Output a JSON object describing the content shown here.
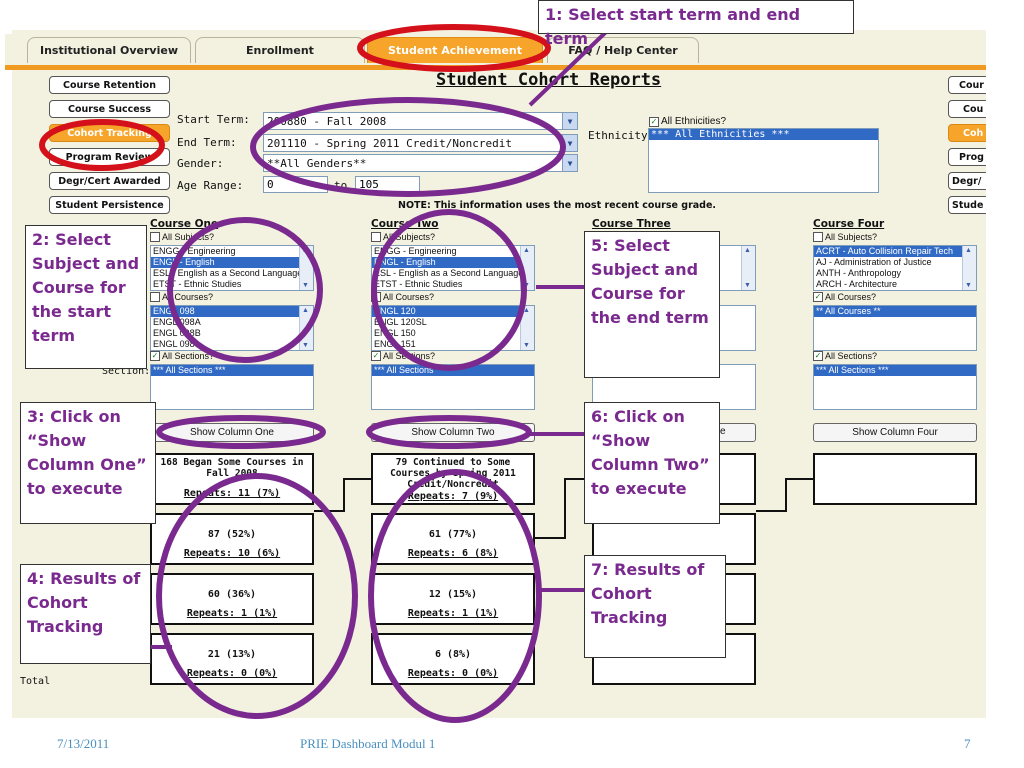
{
  "tabs": [
    "Institutional Overview",
    "Enrollment",
    "Student Achievement",
    "FAQ / Help Center"
  ],
  "page_title": "Student Cohort Reports",
  "side_buttons_left": [
    "Course Retention",
    "Course Success",
    "Cohort Tracking",
    "Program Review",
    "Degr/Cert Awarded",
    "Student Persistence"
  ],
  "side_buttons_right": [
    "Cour",
    "Cou",
    "Coh",
    "Prog",
    "Degr/",
    "Stude"
  ],
  "filters": {
    "start_term_label": "Start Term:",
    "start_term_value": "200880 - Fall 2008",
    "end_term_label": "End Term:",
    "end_term_value": "201110 - Spring 2011 Credit/Noncredit",
    "gender_label": "Gender:",
    "gender_value": "**All Genders**",
    "age_label": "Age Range:",
    "age_from": "0",
    "age_to_label": "to",
    "age_to": "105",
    "ethnicity_label": "Ethnicity:",
    "all_eth_label": "All Ethnicities?",
    "eth_value": "*** All Ethnicities ***",
    "note": "NOTE: This information uses the most recent course grade."
  },
  "columns": [
    {
      "head": "Course One",
      "all_subjects": "All Subjects?",
      "subjects": [
        "ENGG - Engineering",
        "ENGL - English",
        "ESL - English as a Second Language",
        "ETST - Ethnic Studies"
      ],
      "subject_hl": 1,
      "all_courses": "All Courses?",
      "courses": [
        "ENGL 098",
        "ENGL 098A",
        "ENGL 098B",
        "ENGL 098"
      ],
      "all_sections": "All Sections?",
      "sections": "*** All Sections ***",
      "button": "Show Column One",
      "results": [
        {
          "top": "168 Began Some Courses in Fall 2008",
          "rep": "Repeats: 11 (7%)"
        },
        {
          "top": "87 (52%)",
          "rep": "Repeats: 10 (6%)"
        },
        {
          "top": "60 (36%)",
          "rep": "Repeats: 1 (1%)"
        },
        {
          "top": "21 (13%)",
          "rep": "Repeats: 0 (0%)"
        }
      ]
    },
    {
      "head": "Course Two",
      "all_subjects": "All Subjects?",
      "subjects": [
        "ENGG - Engineering",
        "ENGL - English",
        "ESL - English as a Second Language",
        "ETST - Ethnic Studies"
      ],
      "subject_hl": 1,
      "all_courses": "All Courses?",
      "courses": [
        "ENGL 120",
        "ENGL 120SL",
        "ENGL 150",
        "ENGL 151"
      ],
      "all_sections": "All Sections?",
      "sections": "*** All Sections ***",
      "button": "Show Column Two",
      "results": [
        {
          "top": "79 Continued to Some Courses by Spring 2011 Credit/Noncredit",
          "rep": "Repeats: 7 (9%)"
        },
        {
          "top": "61 (77%)",
          "rep": "Repeats: 6 (8%)"
        },
        {
          "top": "12 (15%)",
          "rep": "Repeats: 1 (1%)"
        },
        {
          "top": "6 (8%)",
          "rep": "Repeats: 0 (0%)"
        }
      ]
    },
    {
      "head": "Course Three",
      "button": "Show Column Three"
    },
    {
      "head": "Course Four",
      "all_subjects": "All Subjects?",
      "subjects": [
        "ACRT - Auto Collision Repair Tech",
        "AJ - Administration of Justice",
        "ANTH - Anthropology",
        "ARCH - Architecture"
      ],
      "subject_hl": 0,
      "all_courses": "All Courses?",
      "courses": [
        "** All Courses **"
      ],
      "all_sections": "All Sections?",
      "sections": "*** All Sections ***",
      "button": "Show Column Four"
    }
  ],
  "row_labels": {
    "section": "Section:",
    "total": "Total"
  },
  "callouts": {
    "c1": "1: Select start term and end term",
    "c2": "2: Select Subject and Course for the start term",
    "c3": "3: Click on “Show Column One” to execute",
    "c4": "4: Results of Cohort Tracking",
    "c5": "5: Select Subject and Course for the end term",
    "c6": "6: Click on “Show Column Two” to execute",
    "c7": "7: Results of Cohort Tracking"
  },
  "footer": {
    "date": "7/13/2011",
    "title": "PRIE Dashboard Modul 1",
    "page": "7"
  },
  "colors": {
    "accent": "#f6a52a",
    "annotation": "#7a2a8e",
    "oval_red": "#d4101a",
    "oval_purple": "#7a2a8e",
    "footer_text": "#4a8fbf"
  }
}
